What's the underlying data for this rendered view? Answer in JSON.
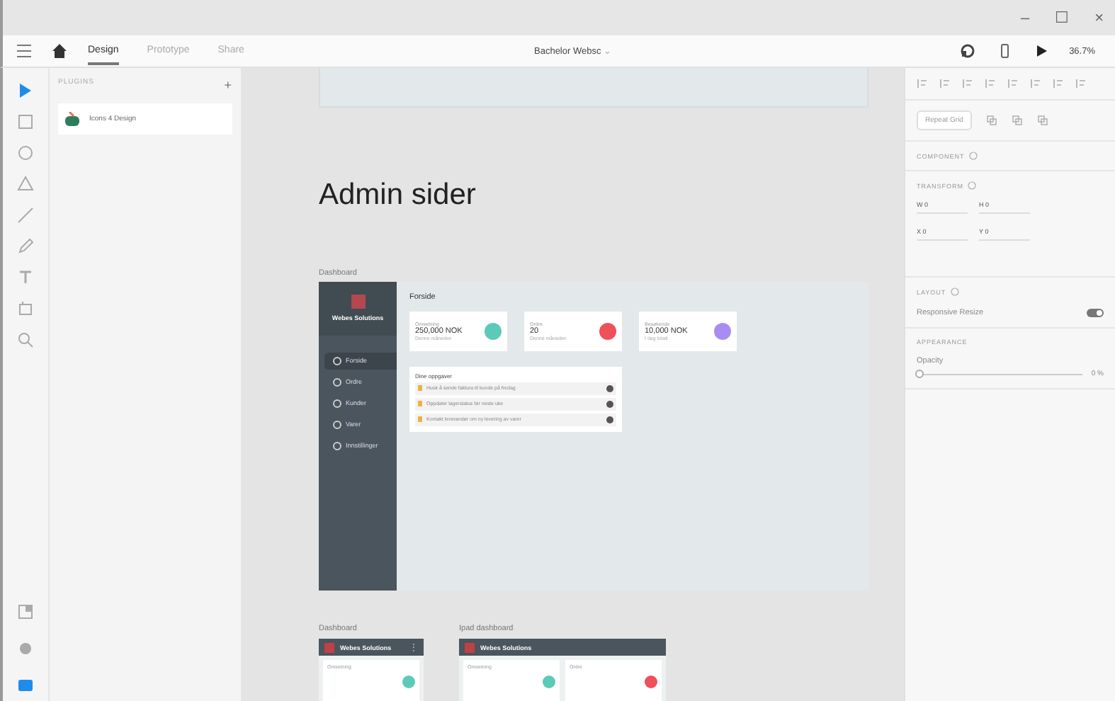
{
  "window": {
    "controls": [
      "–",
      "☐",
      "×"
    ]
  },
  "toolbar": {
    "tabs": [
      {
        "label": "Design",
        "selected": true
      },
      {
        "label": "Prototype",
        "selected": false
      },
      {
        "label": "Share",
        "selected": false
      }
    ],
    "document_title": "Bachelor Websc",
    "dropdown": "⌄",
    "zoom": "36.7%"
  },
  "tools": [
    {
      "kind": "select",
      "selected": true
    },
    {
      "kind": "rectangle",
      "selected": false
    },
    {
      "kind": "ellipse",
      "selected": false
    },
    {
      "kind": "polygon",
      "selected": false
    },
    {
      "kind": "line",
      "selected": false
    },
    {
      "kind": "pen",
      "selected": false
    },
    {
      "kind": "text",
      "selected": false
    },
    {
      "kind": "artboard",
      "selected": false
    },
    {
      "kind": "zoom",
      "selected": false
    }
  ],
  "bottom_tools": [
    {
      "kind": "layers",
      "selected": false
    },
    {
      "kind": "assets",
      "selected": false
    },
    {
      "kind": "plugins",
      "selected": true
    }
  ],
  "plugins_panel": {
    "title": "PLUGINS",
    "add": "+",
    "items": [
      {
        "label": "Icons 4 Design"
      }
    ]
  },
  "canvas": {
    "page_title": "Admin sider",
    "dashboard": {
      "label": "Dashboard",
      "brand": "Webes Solutions",
      "heading": "Forside",
      "nav": [
        {
          "label": "Forside",
          "selected": true
        },
        {
          "label": "Ordre",
          "selected": false
        },
        {
          "label": "Kunder",
          "selected": false
        },
        {
          "label": "Varer",
          "selected": false
        },
        {
          "label": "Innstillinger",
          "selected": false
        }
      ],
      "stats": [
        {
          "label": "Omsetning",
          "value": "250,000 NOK",
          "caption": "Denne måneden",
          "color": "#5ccab8"
        },
        {
          "label": "Ordre",
          "value": "20",
          "caption": "Denne måneden",
          "color": "#f0505a"
        },
        {
          "label": "Besøkende",
          "value": "10,000 NOK",
          "caption": "I dag totalt",
          "color": "#a98cf2"
        }
      ],
      "tasks": {
        "title": "Dine oppgaver",
        "items": [
          {
            "text": "Husk å sende faktura til kunde på fredag"
          },
          {
            "text": "Oppdater lagerstatus før neste uke"
          },
          {
            "text": "Kontakt leverandør om ny levering av varer"
          }
        ]
      }
    },
    "small_artboards": [
      {
        "label": "Dashboard",
        "brand": "Webes Solutions",
        "menu": "⋮",
        "cards": [
          {
            "label": "Omsetning",
            "color": "#5ccab8"
          }
        ]
      },
      {
        "label": "Ipad dashboard",
        "brand": "Webes Solutions",
        "cards": [
          {
            "label": "Omsetning",
            "color": "#5ccab8"
          },
          {
            "label": "Ordre",
            "color": "#f0505a"
          }
        ]
      }
    ]
  },
  "inspector": {
    "repeat_grid": "Repeat Grid",
    "component": "COMPONENT",
    "transform": "TRANSFORM",
    "fields": [
      {
        "label": "W",
        "value": "0"
      },
      {
        "label": "H",
        "value": "0"
      },
      {
        "label": "X",
        "value": "0"
      },
      {
        "label": "Y",
        "value": "0"
      }
    ],
    "layout": "LAYOUT",
    "responsive_resize": {
      "label": "Responsive Resize",
      "on": true
    },
    "appearance": "APPEARANCE",
    "opacity": {
      "label": "Opacity",
      "level": 0,
      "reading": "0 %"
    }
  }
}
